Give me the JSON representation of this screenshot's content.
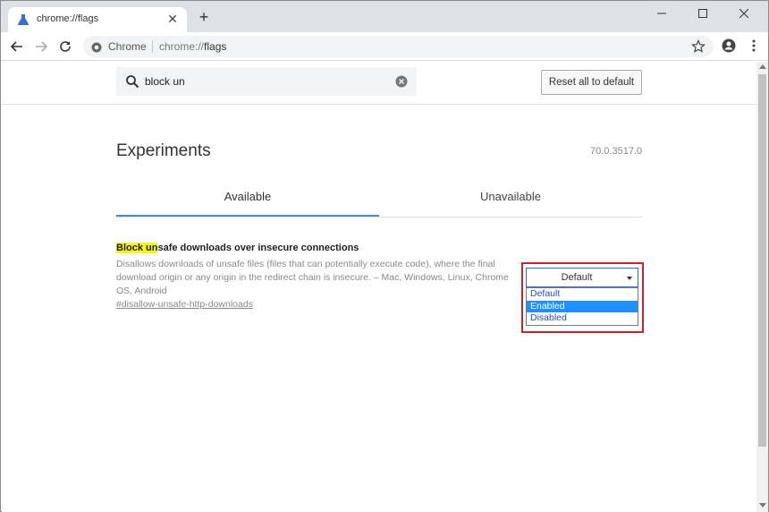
{
  "browser": {
    "tab": {
      "title": "chrome://flags"
    },
    "omnibox": {
      "chip": "Chrome",
      "url_prefix": "chrome://",
      "url_path": "flags"
    }
  },
  "header": {
    "search": {
      "value": "block un",
      "placeholder": "Search flags"
    },
    "reset_label": "Reset all to default"
  },
  "page": {
    "title": "Experiments",
    "version": "70.0.3517.0",
    "tabs": [
      {
        "label": "Available",
        "active": true
      },
      {
        "label": "Unavailable",
        "active": false
      }
    ]
  },
  "experiment": {
    "title_highlight": "Block un",
    "title_rest": "safe downloads over insecure connections",
    "description": "Disallows downloads of unsafe files (files that can potentially execute code), where the final download origin or any origin in the redirect chain is insecure. – Mac, Windows, Linux, Chrome OS, Android",
    "link": "#disallow-unsafe-http-downloads",
    "select": {
      "value": "Default",
      "options": [
        "Default",
        "Enabled",
        "Disabled"
      ],
      "highlighted_option": "Enabled"
    }
  },
  "colors": {
    "accent": "#4285f4",
    "highlight": "#f4f41e",
    "annotation_box": "#c0262b",
    "selected_option": "#1e90ff"
  }
}
